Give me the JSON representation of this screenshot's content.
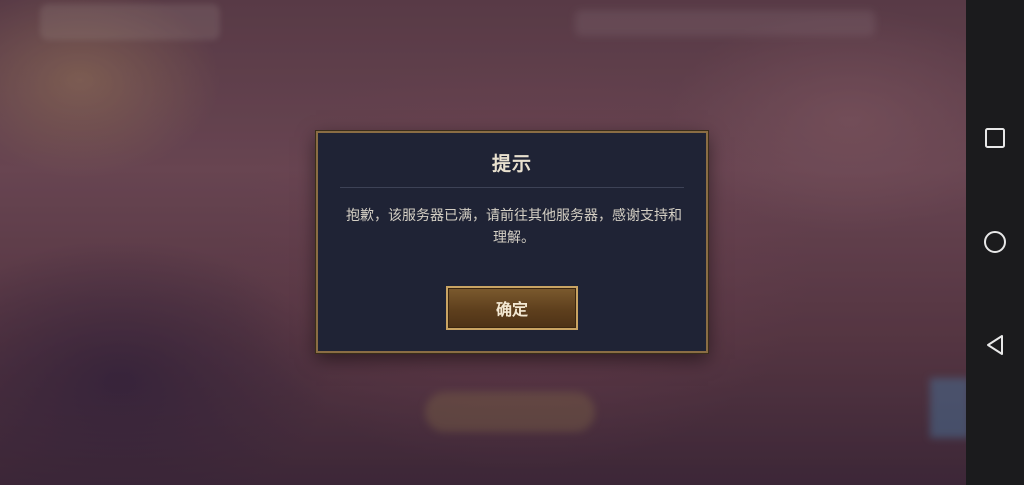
{
  "dialog": {
    "title": "提示",
    "message": "抱歉，该服务器已满，请前往其他服务器，感谢支持和理解。",
    "confirm_label": "确定"
  },
  "nav_bar": {
    "buttons": [
      {
        "icon": "square-recent-apps-icon"
      },
      {
        "icon": "circle-home-icon"
      },
      {
        "icon": "triangle-back-icon"
      }
    ]
  }
}
